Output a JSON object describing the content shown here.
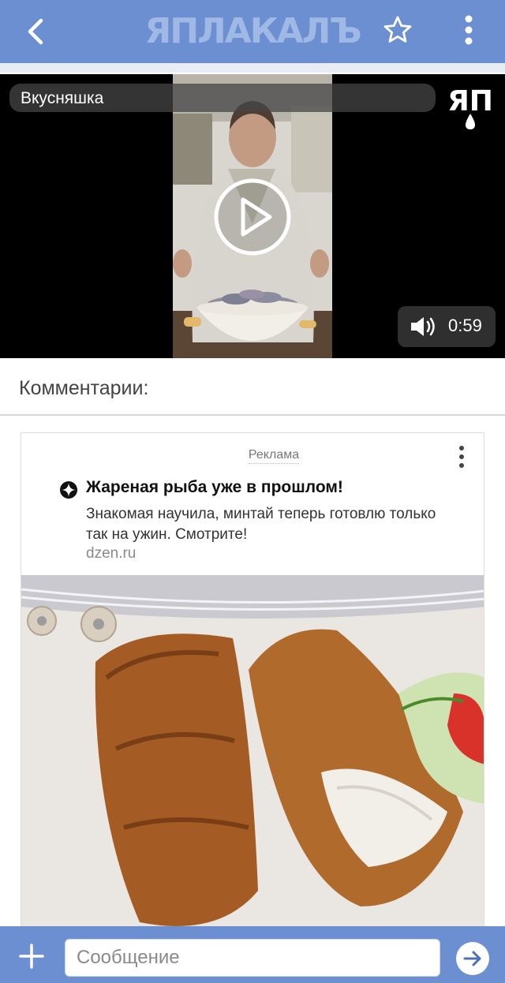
{
  "header": {
    "logo_text": "ЯПЛАКАЛЪ",
    "accent_color": "#6b8fd0",
    "icons": {
      "back": "chevron-left-icon",
      "favorite": "star-icon",
      "menu": "more-vertical-icon"
    }
  },
  "video": {
    "title": "Вкусняшка",
    "watermark": "ЯП",
    "duration": "0:59",
    "icons": {
      "play": "play-icon",
      "volume": "volume-icon"
    }
  },
  "comments": {
    "header": "Комментарии:"
  },
  "ad": {
    "label": "Реклама",
    "title": "Жареная рыба уже в прошлом!",
    "text": "Знакомая научила, минтай теперь готовлю только так на ужин. Смотрите!",
    "domain": "dzen.ru"
  },
  "composer": {
    "placeholder": "Сообщение",
    "icons": {
      "add": "plus-icon",
      "send": "send-arrow-icon"
    }
  }
}
